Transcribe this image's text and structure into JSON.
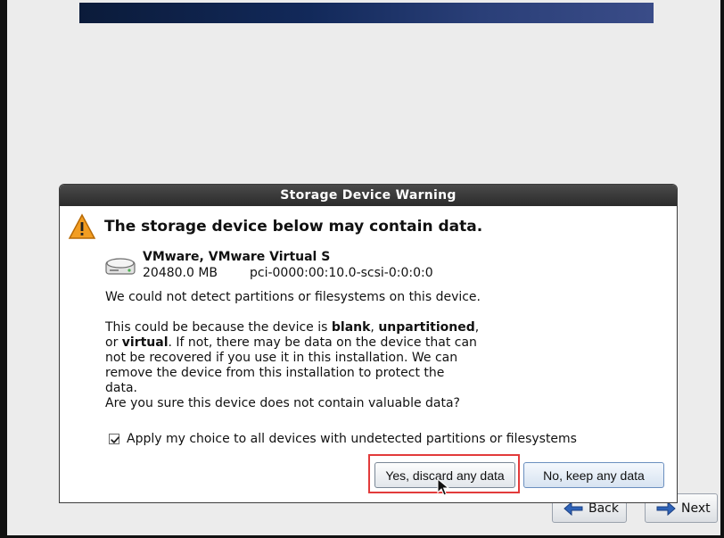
{
  "window": {
    "background": "#ececec",
    "banner_color_start": "#0b1b3a",
    "banner_color_end": "#3a4c88"
  },
  "nav": {
    "back_label": "Back",
    "next_label": "Next",
    "back_icon": "arrow-left-icon",
    "next_icon": "arrow-right-icon"
  },
  "dialog": {
    "title": "Storage Device Warning",
    "headline": "The storage device below may contain data.",
    "warning_icon": "warning-triangle-icon",
    "device": {
      "icon": "hard-drive-icon",
      "name": "VMware, VMware Virtual S",
      "size": "20480.0 MB",
      "path": "pci-0000:00:10.0-scsi-0:0:0:0"
    },
    "text": {
      "p1": "We could not detect partitions or filesystems on this device.",
      "p2_line1_prefix": "This could be because the device is ",
      "p2_bold_blank": "blank",
      "p2_comma_1": ", ",
      "p2_bold_unpartitioned": "unpartitioned",
      "p2_comma_2": ",",
      "p2_line2_prefix": "or ",
      "p2_bold_virtual": "virtual",
      "p2_line2_suffix": ". If not, there may be data on the device that can",
      "p2_line3": "not be recovered if you use it in this installation. We can",
      "p2_line4": "remove the device from this installation to protect the data.",
      "p3": "Are you sure this device does not contain valuable data?"
    },
    "checkbox": {
      "checked": true,
      "label": "Apply my choice to all devices with undetected partitions or filesystems"
    },
    "buttons": {
      "yes_label": "Yes, discard any data",
      "no_label": "No, keep any data"
    }
  },
  "annotations": {
    "highlight_color": "#e23b3b"
  }
}
